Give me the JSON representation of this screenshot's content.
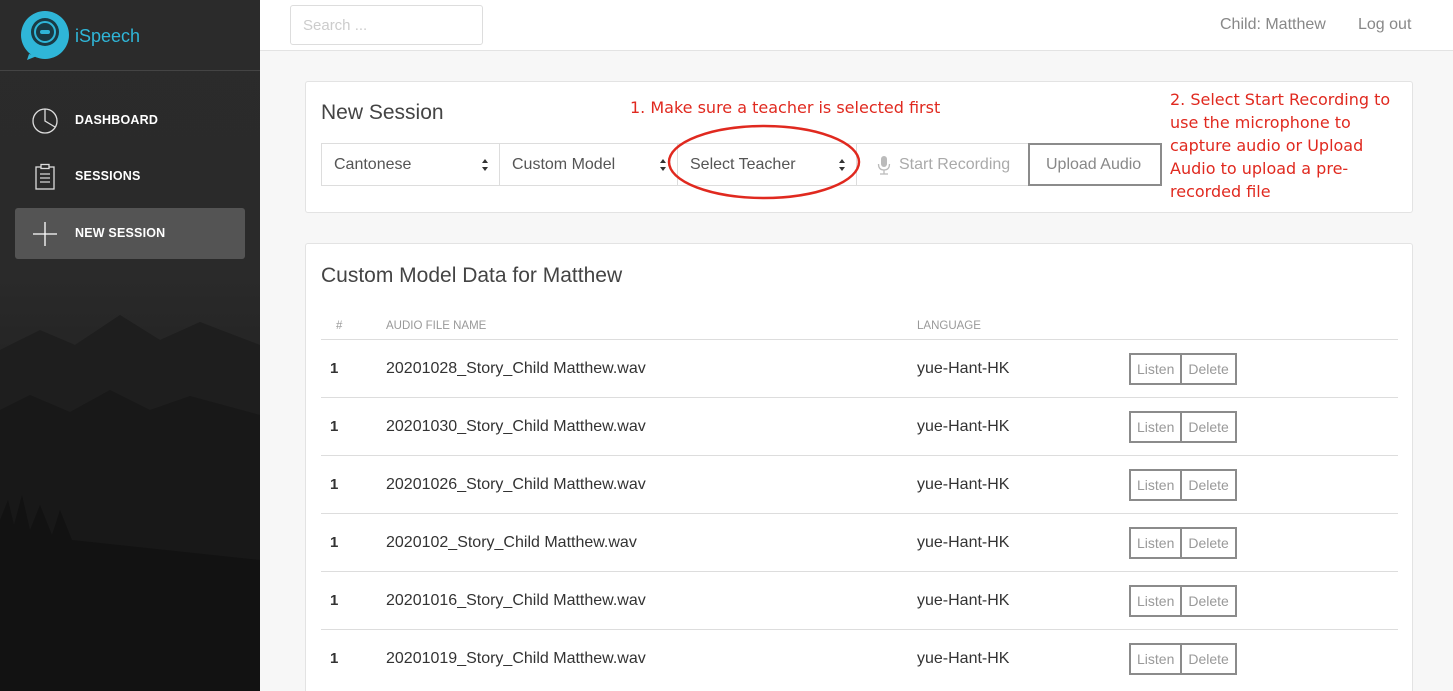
{
  "brand": {
    "name": "iSpeech",
    "logo_text": "iSpeech"
  },
  "sidebar": {
    "items": [
      {
        "label": "DASHBOARD",
        "icon": "pie-chart-icon"
      },
      {
        "label": "SESSIONS",
        "icon": "clipboard-icon"
      },
      {
        "label": "NEW SESSION",
        "icon": "plus-icon",
        "active": true
      }
    ]
  },
  "topbar": {
    "search_placeholder": "Search ...",
    "child": "Child: Matthew",
    "logout": "Log out"
  },
  "new_session": {
    "title": "New Session",
    "language": "Cantonese",
    "model": "Custom Model",
    "teacher": "Select Teacher",
    "start_recording": "Start Recording",
    "upload_audio": "Upload Audio"
  },
  "annotations": {
    "note1": "1. Make sure a teacher is selected first",
    "note2": "2. Select Start Recording to use the microphone to capture audio or Upload Audio to upload a pre-recorded file"
  },
  "custom_model": {
    "title": "Custom Model Data for Matthew",
    "columns": [
      "#",
      "AUDIO FILE NAME",
      "LANGUAGE"
    ],
    "listen_label": "Listen",
    "delete_label": "Delete",
    "rows": [
      {
        "num": "1",
        "file": "20201028_Story_Child Matthew.wav",
        "lang": "yue-Hant-HK"
      },
      {
        "num": "1",
        "file": "20201030_Story_Child Matthew.wav",
        "lang": "yue-Hant-HK"
      },
      {
        "num": "1",
        "file": "20201026_Story_Child Matthew.wav",
        "lang": "yue-Hant-HK"
      },
      {
        "num": "1",
        "file": "2020102_Story_Child Matthew.wav",
        "lang": "yue-Hant-HK"
      },
      {
        "num": "1",
        "file": "20201016_Story_Child Matthew.wav",
        "lang": "yue-Hant-HK"
      },
      {
        "num": "1",
        "file": "20201019_Story_Child Matthew.wav",
        "lang": "yue-Hant-HK"
      }
    ]
  },
  "colors": {
    "brand": "#2fb6d8",
    "annotation": "#e0291f",
    "sidebar_bg": "#2b2b2b"
  }
}
